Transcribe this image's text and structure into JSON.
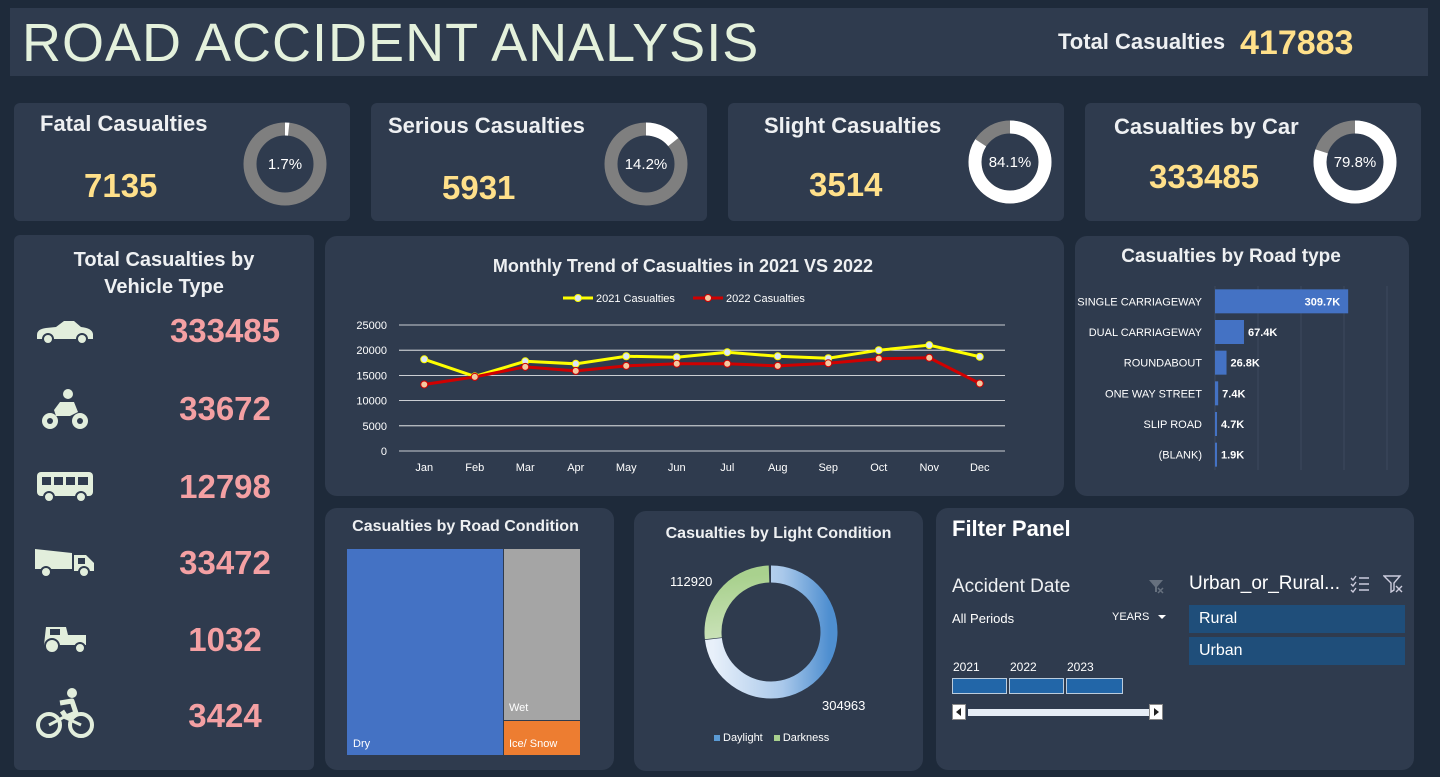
{
  "header": {
    "title": "ROAD ACCIDENT ANALYSIS",
    "total_label": "Total Casualties",
    "total_value": "417883"
  },
  "kpis": [
    {
      "label": "Fatal Casualties",
      "value": "7135",
      "pct": "1.7%",
      "fraction": 0.017
    },
    {
      "label": "Serious Casualties",
      "value": "5931",
      "pct": "14.2%",
      "fraction": 0.142
    },
    {
      "label": "Slight Casualties",
      "value": "3514",
      "pct": "84.1%",
      "fraction": 0.841
    },
    {
      "label": "Casualties by Car",
      "value": "333485",
      "pct": "79.8%",
      "fraction": 0.798
    }
  ],
  "vehicle": {
    "title_line1": "Total Casualties by",
    "title_line2": "Vehicle Type",
    "items": [
      {
        "icon": "car-icon",
        "value": "333485"
      },
      {
        "icon": "motorcycle-icon",
        "value": "33672"
      },
      {
        "icon": "bus-icon",
        "value": "12798"
      },
      {
        "icon": "truck-icon",
        "value": "33472"
      },
      {
        "icon": "tractor-icon",
        "value": "1032"
      },
      {
        "icon": "bicycle-icon",
        "value": "3424"
      }
    ]
  },
  "colors": {
    "series_2021": "#ffff00",
    "series_2022": "#d00000",
    "bar": "#4472c4",
    "dry": "#4472c4",
    "wet": "#a5a5a5",
    "ice": "#ed7d31",
    "daylight": "#5b9bd5",
    "darkness": "#a9d18e"
  },
  "chart_data": [
    {
      "type": "line",
      "title": "Monthly Trend of Casualties in 2021 VS 2022",
      "categories": [
        "Jan",
        "Feb",
        "Mar",
        "Apr",
        "May",
        "Jun",
        "Jul",
        "Aug",
        "Sep",
        "Oct",
        "Nov",
        "Dec"
      ],
      "yticks": [
        "0",
        "5000",
        "10000",
        "15000",
        "20000",
        "25000"
      ],
      "ylim": [
        0,
        25000
      ],
      "grid": true,
      "legend_position": "top",
      "series": [
        {
          "name": "2021 Casualties",
          "values": [
            18200,
            14800,
            17800,
            17300,
            18800,
            18600,
            19600,
            18800,
            18400,
            20000,
            21000,
            18700
          ]
        },
        {
          "name": "2022 Casualties",
          "values": [
            13200,
            14700,
            16700,
            15900,
            16900,
            17300,
            17300,
            16900,
            17400,
            18300,
            18500,
            13400
          ]
        }
      ]
    },
    {
      "type": "bar",
      "orientation": "horizontal",
      "title": "Casualties by Road type",
      "categories": [
        "SINGLE CARRIAGEWAY",
        "DUAL CARRIAGEWAY",
        "ROUNDABOUT",
        "ONE WAY STREET",
        "SLIP ROAD",
        "(BLANK)"
      ],
      "values": [
        309700,
        67400,
        26800,
        7400,
        4700,
        1900
      ],
      "labels": [
        "309.7K",
        "67.4K",
        "26.8K",
        "7.4K",
        "4.7K",
        "1.9K"
      ],
      "xlim": [
        0,
        400000
      ]
    },
    {
      "type": "treemap",
      "title": "Casualties by Road Condition",
      "categories": [
        "Dry",
        "Wet",
        "Ice/ Snow"
      ],
      "values": [
        279445,
        107967,
        30471
      ]
    },
    {
      "type": "pie",
      "donut": true,
      "title": "Casualties by Light Condition",
      "categories": [
        "Daylight",
        "Darkness"
      ],
      "values": [
        304963,
        112920
      ],
      "labels": [
        "304963",
        "112920"
      ],
      "legend_position": "bottom"
    }
  ],
  "filter": {
    "title": "Filter Panel",
    "date_label": "Accident Date",
    "all_periods": "All Periods",
    "years_label": "YEARS",
    "years": [
      "2021",
      "2022",
      "2023"
    ],
    "slicer_title": "Urban_or_Rural...",
    "options": [
      "Rural",
      "Urban"
    ]
  }
}
